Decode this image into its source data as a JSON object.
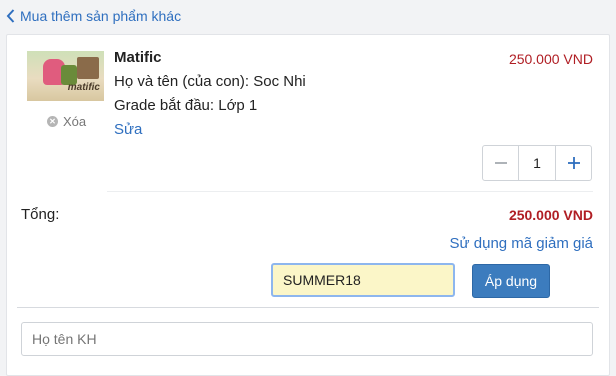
{
  "back_link": {
    "label": "Mua thêm sản phẩm khác",
    "icon": "chevron-left-icon"
  },
  "item": {
    "name": "Matific",
    "child_name_line": "Họ và tên (của con): Soc Nhi",
    "grade_line": "Grade bắt đầu: Lớp 1",
    "edit_label": "Sửa",
    "remove_label": "Xóa",
    "price": "250.000 VND",
    "quantity": "1",
    "thumbnail_logo": "matific"
  },
  "summary": {
    "total_label": "Tổng:",
    "total_value": "250.000 VND",
    "coupon_link": "Sử dụng mã giảm giá",
    "coupon_value": "SUMMER18",
    "apply_label": "Áp dụng"
  },
  "customer": {
    "name_placeholder": "Họ tên KH"
  },
  "colors": {
    "accent": "#2f6fbf",
    "price": "#b01e24",
    "button": "#3c7cbe",
    "coupon_bg": "#fbf6c8"
  }
}
